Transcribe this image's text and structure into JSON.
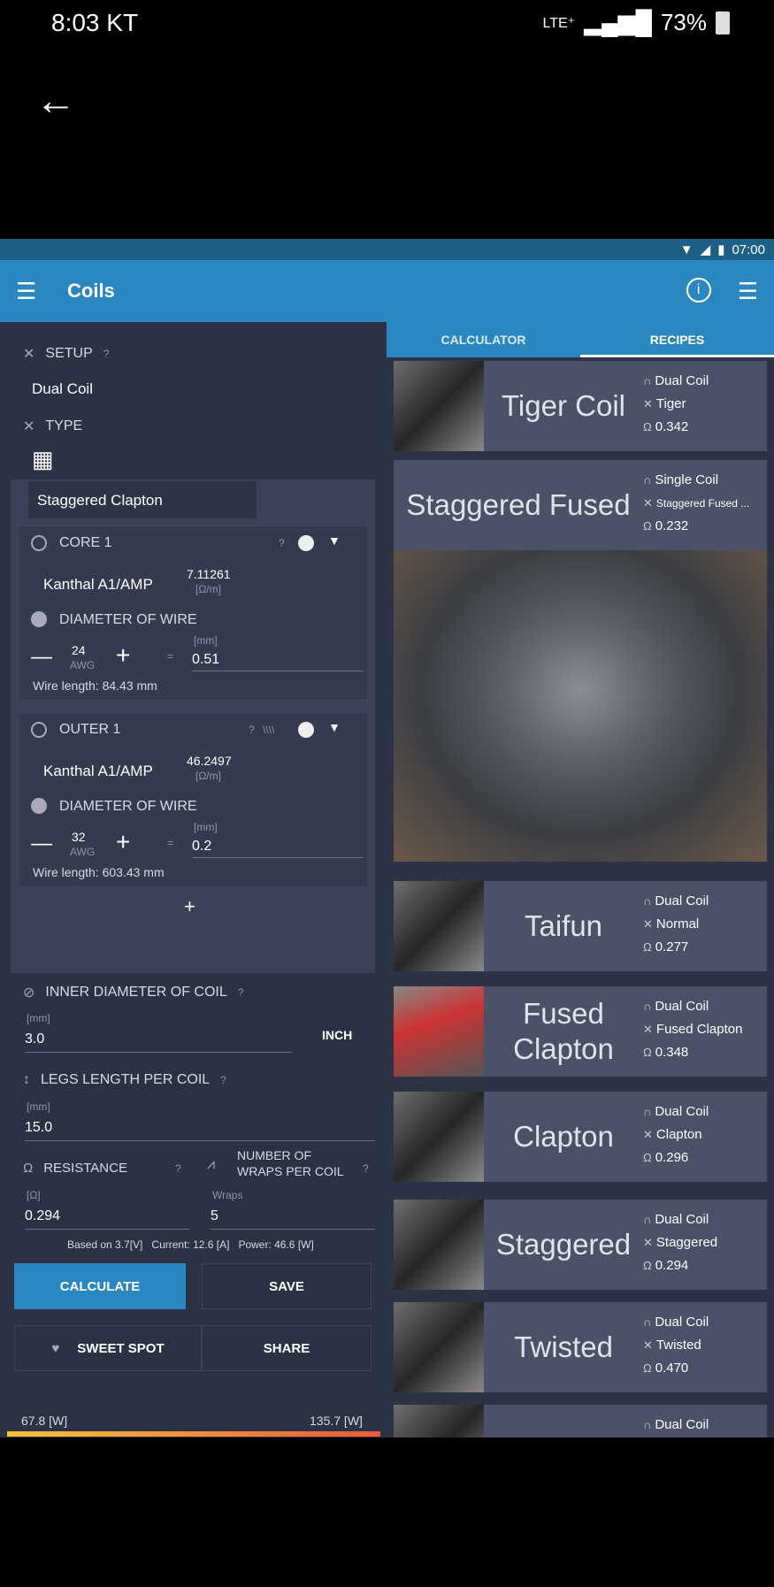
{
  "phone": {
    "time": "8:03 KT",
    "network": "LTE⁺",
    "battery": "73%"
  },
  "app": {
    "inner_status_time": "07:00",
    "toolbar_title": "Coils",
    "tabs": [
      "CALCULATOR",
      "RECIPES"
    ],
    "setup": {
      "label": "SETUP",
      "help": "?",
      "value": "Dual Coil"
    },
    "type": {
      "label": "TYPE",
      "value": "Staggered Clapton"
    },
    "core": {
      "label": "CORE 1",
      "help": "?",
      "material": "Kanthal A1/AMP",
      "resistivity": "7.11261",
      "unit": "[Ω/m]",
      "diameter_label": "DIAMETER OF WIRE",
      "awg": "24",
      "awg_unit": "AWG",
      "mm_unit": "[mm]",
      "mm_value": "0.51",
      "wire_length": "Wire length: 84.43 mm"
    },
    "outer": {
      "label": "OUTER 1",
      "help": "?",
      "material": "Kanthal A1/AMP",
      "resistivity": "46.2497",
      "unit": "[Ω/m]",
      "diameter_label": "DIAMETER OF WIRE",
      "awg": "32",
      "awg_unit": "AWG",
      "mm_unit": "[mm]",
      "mm_value": "0.2",
      "wire_length": "Wire length: 603.43 mm"
    },
    "inner_diameter": {
      "label": "INNER DIAMETER OF COIL",
      "help": "?",
      "unit": "[mm]",
      "value": "3.0",
      "inch_btn": "INCH"
    },
    "legs": {
      "label": "LEGS LENGTH PER COIL",
      "help": "?",
      "unit": "[mm]",
      "value": "15.0"
    },
    "resistance": {
      "label": "RESISTANCE",
      "help": "?",
      "unit": "[Ω]",
      "value": "0.294"
    },
    "wraps": {
      "label1": "NUMBER OF",
      "label2": "WRAPS PER COIL",
      "help": "?",
      "unit": "Wraps",
      "value": "5"
    },
    "based_on": "Based on 3.7[V]   Current: 12.6 [A]   Power: 46.6 [W]",
    "buttons": {
      "calculate": "CALCULATE",
      "save": "SAVE",
      "sweet_spot": "SWEET SPOT",
      "share": "SHARE"
    },
    "power_min": "67.8 [W]",
    "power_max": "135.7 [W]",
    "recipes": [
      {
        "name": "Tiger Coil",
        "setup": "Dual Coil",
        "type": "Tiger",
        "ohm": "0.342"
      },
      {
        "name": "Staggered Fused",
        "setup": "Single Coil",
        "type": "Staggered Fused ...",
        "ohm": "0.232"
      },
      {
        "name": "Taifun",
        "setup": "Dual Coil",
        "type": "Normal",
        "ohm": "0.277"
      },
      {
        "name": "Fused Clapton",
        "setup": "Dual Coil",
        "type": "Fused Clapton",
        "ohm": "0.348"
      },
      {
        "name": "Clapton",
        "setup": "Dual Coil",
        "type": "Clapton",
        "ohm": "0.296"
      },
      {
        "name": "Staggered",
        "setup": "Dual Coil",
        "type": "Staggered",
        "ohm": "0.294"
      },
      {
        "name": "Twisted",
        "setup": "Dual Coil",
        "type": "Twisted",
        "ohm": "0.470"
      },
      {
        "name": "",
        "setup": "Dual Coil",
        "type": "",
        "ohm": ""
      }
    ]
  }
}
